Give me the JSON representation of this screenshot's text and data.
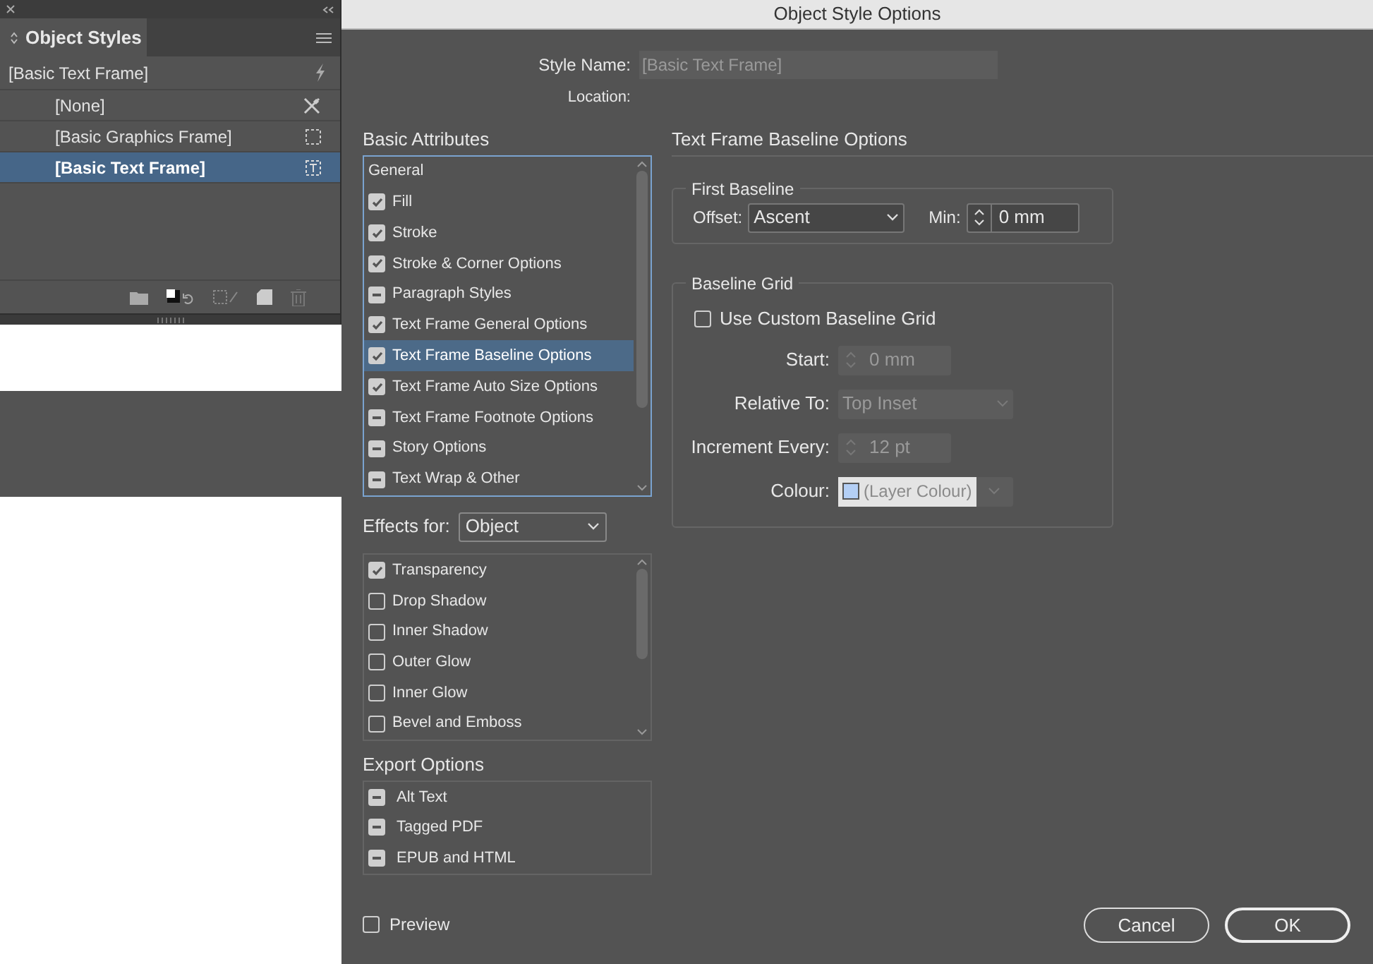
{
  "panel": {
    "title": "Object Styles",
    "current_style": "[Basic Text Frame]",
    "styles": [
      {
        "label": "[None]",
        "selected": false
      },
      {
        "label": "[Basic Graphics Frame]",
        "selected": false
      },
      {
        "label": "[Basic Text Frame]",
        "selected": true
      }
    ]
  },
  "dialog": {
    "title": "Object Style Options",
    "style_name": {
      "label": "Style Name:",
      "value": "[Basic Text Frame]",
      "disabled": true
    },
    "location": {
      "label": "Location:"
    },
    "basic_attributes": {
      "heading": "Basic Attributes",
      "items": [
        {
          "label": "General",
          "kind": "heading",
          "selected": false
        },
        {
          "label": "Fill",
          "kind": "option",
          "checked": true,
          "selected": false
        },
        {
          "label": "Stroke",
          "kind": "option",
          "checked": true,
          "selected": false
        },
        {
          "label": "Stroke & Corner Options",
          "kind": "option",
          "checked": true,
          "selected": false
        },
        {
          "label": "Paragraph Styles",
          "kind": "ignored",
          "selected": false
        },
        {
          "label": "Text Frame General Options",
          "kind": "option",
          "checked": true,
          "selected": false
        },
        {
          "label": "Text Frame Baseline Options",
          "kind": "option",
          "checked": true,
          "selected": true
        },
        {
          "label": "Text Frame Auto Size Options",
          "kind": "option",
          "checked": true,
          "selected": false
        },
        {
          "label": "Text Frame Footnote Options",
          "kind": "ignored",
          "selected": false
        },
        {
          "label": "Story Options",
          "kind": "ignored",
          "selected": false
        },
        {
          "label": "Text Wrap & Other",
          "kind": "ignored",
          "selected": false
        }
      ]
    },
    "effects_for": {
      "label": "Effects for:",
      "value": "Object"
    },
    "effects": [
      {
        "label": "Transparency",
        "checked": true
      },
      {
        "label": "Drop Shadow",
        "checked": false
      },
      {
        "label": "Inner Shadow",
        "checked": false
      },
      {
        "label": "Outer Glow",
        "checked": false
      },
      {
        "label": "Inner Glow",
        "checked": false
      },
      {
        "label": "Bevel and Emboss",
        "checked": false
      }
    ],
    "export_options": {
      "heading": "Export Options",
      "items": [
        {
          "label": "Alt Text",
          "mixed": true
        },
        {
          "label": "Tagged PDF",
          "mixed": true
        },
        {
          "label": "EPUB and HTML",
          "mixed": true
        }
      ]
    },
    "preview": {
      "label": "Preview",
      "checked": false
    },
    "section_title": "Text Frame Baseline Options",
    "first_baseline": {
      "title": "First Baseline",
      "offset_label": "Offset:",
      "offset_value": "Ascent",
      "min_label": "Min:",
      "min_value": "0 mm"
    },
    "baseline_grid": {
      "title": "Baseline Grid",
      "use_custom": {
        "label": "Use Custom Baseline Grid",
        "checked": false
      },
      "start_label": "Start:",
      "start_value": "0 mm",
      "relative_label": "Relative To:",
      "relative_value": "Top Inset",
      "increment_label": "Increment Every:",
      "increment_value": "12 pt",
      "colour_label": "Colour:",
      "colour_value": "(Layer Colour)"
    },
    "buttons": [
      {
        "label": "Cancel",
        "default": false
      },
      {
        "label": "OK",
        "default": true
      }
    ]
  }
}
